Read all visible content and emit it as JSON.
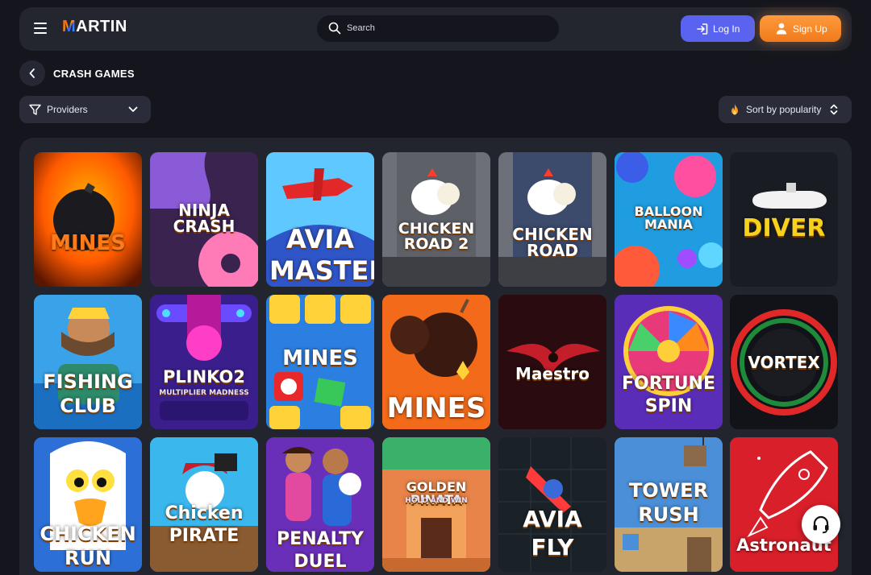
{
  "header": {
    "logo": {
      "first": "M",
      "rest": "ARTIN"
    },
    "search": {
      "placeholder": "Search"
    },
    "login_label": "Log In",
    "signup_label": "Sign Up"
  },
  "breadcrumb": {
    "title": "CRASH GAMES"
  },
  "filters": {
    "providers_label": "Providers",
    "sort_label": "Sort by popularity"
  },
  "games": [
    {
      "name": "mines-1",
      "title": "MINES",
      "subtitle": "",
      "bg": "#3a1a0c",
      "accent": "#ff7a18"
    },
    {
      "name": "ninja-crash",
      "title": "NINJA CRASH",
      "subtitle": "",
      "bg": "#3b2350",
      "accent": "#ff7bb8"
    },
    {
      "name": "avia-masters",
      "title": "AVIA",
      "subtitle": "MASTERS",
      "bg": "#2aa6f0",
      "accent": "#ffb020"
    },
    {
      "name": "chicken-road-2",
      "title": "CHICKEN ROAD 2",
      "subtitle": "",
      "bg": "#5e6068",
      "accent": "#ffc234"
    },
    {
      "name": "chicken-road",
      "title": "CHICKEN ROAD",
      "subtitle": "",
      "bg": "#3c4a6b",
      "accent": "#ffc234"
    },
    {
      "name": "balloon-mania",
      "title": "BALLOON MANIA",
      "subtitle": "",
      "bg": "#1f9de0",
      "accent": "#ff4fa0"
    },
    {
      "name": "diver",
      "title": "DIVER",
      "subtitle": "",
      "bg": "#1a1c24",
      "accent": "#f6d21c"
    },
    {
      "name": "fishing-club",
      "title": "FISHING",
      "subtitle": "CLUB",
      "bg": "#2d8fd6",
      "accent": "#ffd23a"
    },
    {
      "name": "plinko-2",
      "title": "PLINKO2",
      "subtitle": "MULTIPLIER MADNESS",
      "bg": "#3a1f8c",
      "accent": "#ff3ec8"
    },
    {
      "name": "mines-2",
      "title": "MINES",
      "subtitle": "",
      "bg": "#2b7fe0",
      "accent": "#ffd23a"
    },
    {
      "name": "mines-3",
      "title": "MINES",
      "subtitle": "",
      "bg": "#f26a1a",
      "accent": "#ffffff"
    },
    {
      "name": "maestro",
      "title": "Maestro",
      "subtitle": "",
      "bg": "#2a0c10",
      "accent": "#c41e2a"
    },
    {
      "name": "fortune-spin",
      "title": "FORTUNE",
      "subtitle": "SPIN",
      "bg": "#5a2db8",
      "accent": "#ffcf3a"
    },
    {
      "name": "vortex",
      "title": "VORTEX",
      "subtitle": "",
      "bg": "#121318",
      "accent": "#e02828"
    },
    {
      "name": "chicken-run",
      "title": "CHICKEN",
      "subtitle": "RUN",
      "bg": "#2c6fd6",
      "accent": "#ffd21c"
    },
    {
      "name": "chicken-pirate",
      "title": "Chicken",
      "subtitle": "PIRATE",
      "bg": "#2fb2e8",
      "accent": "#ff8a1c"
    },
    {
      "name": "penalty-duel",
      "title": "PENALTY",
      "subtitle": "DUEL",
      "bg": "#6a2fb8",
      "accent": "#ffcf3a"
    },
    {
      "name": "golden-pinata",
      "title": "GOLDEN PINATA",
      "subtitle": "HOLD AND WIN",
      "bg": "#d85a2a",
      "accent": "#ffd23a"
    },
    {
      "name": "avia-fly",
      "title": "AVIA",
      "subtitle": "FLY",
      "bg": "#1a2228",
      "accent": "#ff3b3b"
    },
    {
      "name": "tower-rush",
      "title": "TOWER",
      "subtitle": "RUSH",
      "bg": "#4a8fd8",
      "accent": "#ffcf3a"
    },
    {
      "name": "astronaut",
      "title": "Astronaut",
      "subtitle": "",
      "bg": "#d81f2a",
      "accent": "#ffffff"
    }
  ],
  "colors": {
    "page_bg": "#15161d",
    "panel_bg": "#22242e",
    "login_bg": "#5a63f0",
    "signup_bg": "#f07a1a"
  }
}
